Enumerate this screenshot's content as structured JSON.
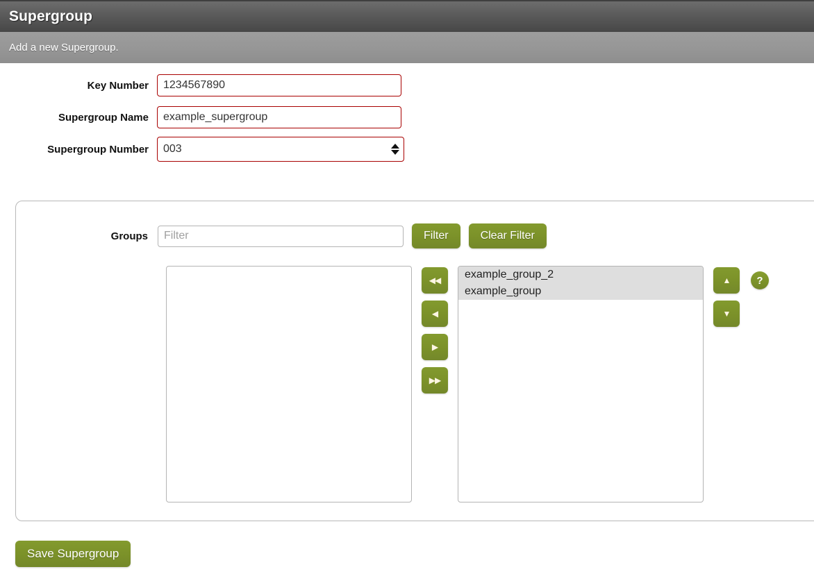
{
  "header": {
    "title": "Supergroup",
    "subtitle": "Add a new Supergroup."
  },
  "form": {
    "fields": [
      {
        "label": "Key Number",
        "value": "1234567890",
        "placeholder": ""
      },
      {
        "label": "Supergroup Name",
        "value": "example_supergroup",
        "placeholder": ""
      },
      {
        "label": "Supergroup Number",
        "value": "003",
        "placeholder": ""
      }
    ]
  },
  "groups": {
    "label": "Groups",
    "filter": {
      "value": "",
      "placeholder": "Filter",
      "filter_button": "Filter",
      "clear_button": "Clear Filter"
    },
    "available_items": [],
    "selected_items": [
      {
        "label": "example_group_2",
        "selected": true
      },
      {
        "label": "example_group",
        "selected": true
      }
    ],
    "transfer_buttons": [
      {
        "icon": "double-left-arrow-icon",
        "glyph": "◀◀"
      },
      {
        "icon": "single-left-arrow-icon",
        "glyph": "◀"
      },
      {
        "icon": "single-right-arrow-icon",
        "glyph": "▶"
      },
      {
        "icon": "double-right-arrow-icon",
        "glyph": "▶▶"
      }
    ],
    "order_buttons": [
      {
        "icon": "move-up-icon",
        "glyph": "▲"
      },
      {
        "icon": "move-down-icon",
        "glyph": "▼"
      }
    ],
    "help": {
      "icon": "help-icon",
      "glyph": "?"
    }
  },
  "actions": {
    "save_label": "Save Supergroup"
  },
  "colors": {
    "accent_green": "#7b9129",
    "input_border_red": "#a80000",
    "header_dark": "#4f4f4f",
    "subheader_gray": "#969696"
  }
}
